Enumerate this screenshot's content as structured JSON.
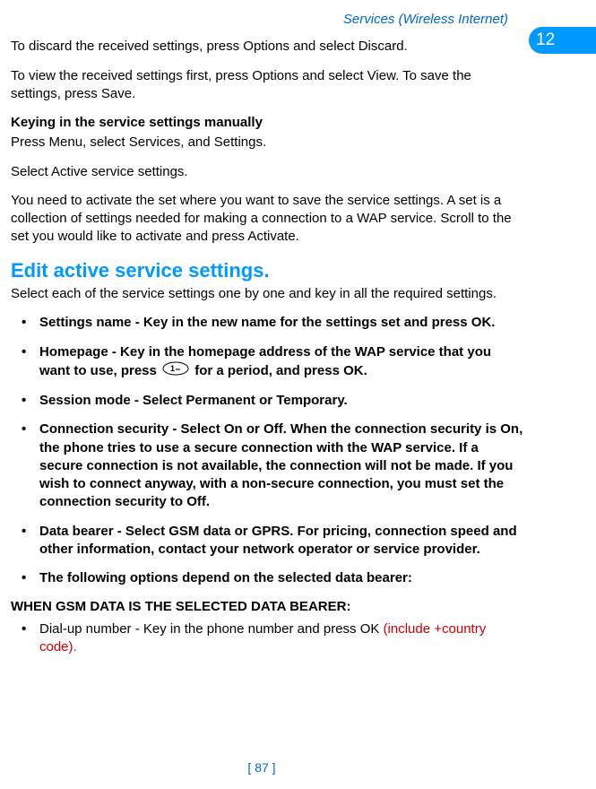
{
  "header": {
    "title": "Services (Wireless Internet)",
    "chapter": "12"
  },
  "paragraphs": {
    "p1": "To discard the received settings, press Options and select Discard.",
    "p2": "To view the received settings first, press Options and select View. To save the settings, press Save.",
    "manual_heading": "Keying in the service settings manually",
    "p3": "Press Menu, select Services, and Settings.",
    "p4": "Select Active service settings.",
    "p5": "You need to activate the set where you want to save the service settings. A set is a collection of settings needed for making a connection to a WAP service. Scroll to the set you would like to activate and press Activate."
  },
  "section": {
    "title": "Edit active service settings.",
    "intro": "Select each of the service settings one by one and key in all the required settings."
  },
  "bullets": {
    "b1": "Settings name - Key in the new name for the settings set and press OK.",
    "b2_part1": "Homepage - Key in the homepage address of the WAP service that you want to use, press ",
    "b2_part2": " for a period, and press OK.",
    "b3": "Session mode - Select Permanent or Temporary.",
    "b4": "Connection security - Select On or Off.  When the connection security is On, the phone tries to use a secure connection with the WAP service. If a secure connection is not available, the connection will not be made. If you wish to connect anyway, with a non-secure connection, you must set the connection security to Off.",
    "b5": "Data bearer - Select GSM data or GPRS. For pricing, connection speed and other information, contact your network operator or service provider.",
    "b6": "The following options depend on the selected data bearer:"
  },
  "gsm": {
    "heading": "WHEN GSM DATA IS THE SELECTED DATA BEARER:",
    "b1_main": "Dial-up number - Key in the phone number and press OK ",
    "b1_annotation": "(include +country code)."
  },
  "footer": {
    "page": "[ 87 ]"
  },
  "icons": {
    "key_1": "key-1-icon"
  }
}
